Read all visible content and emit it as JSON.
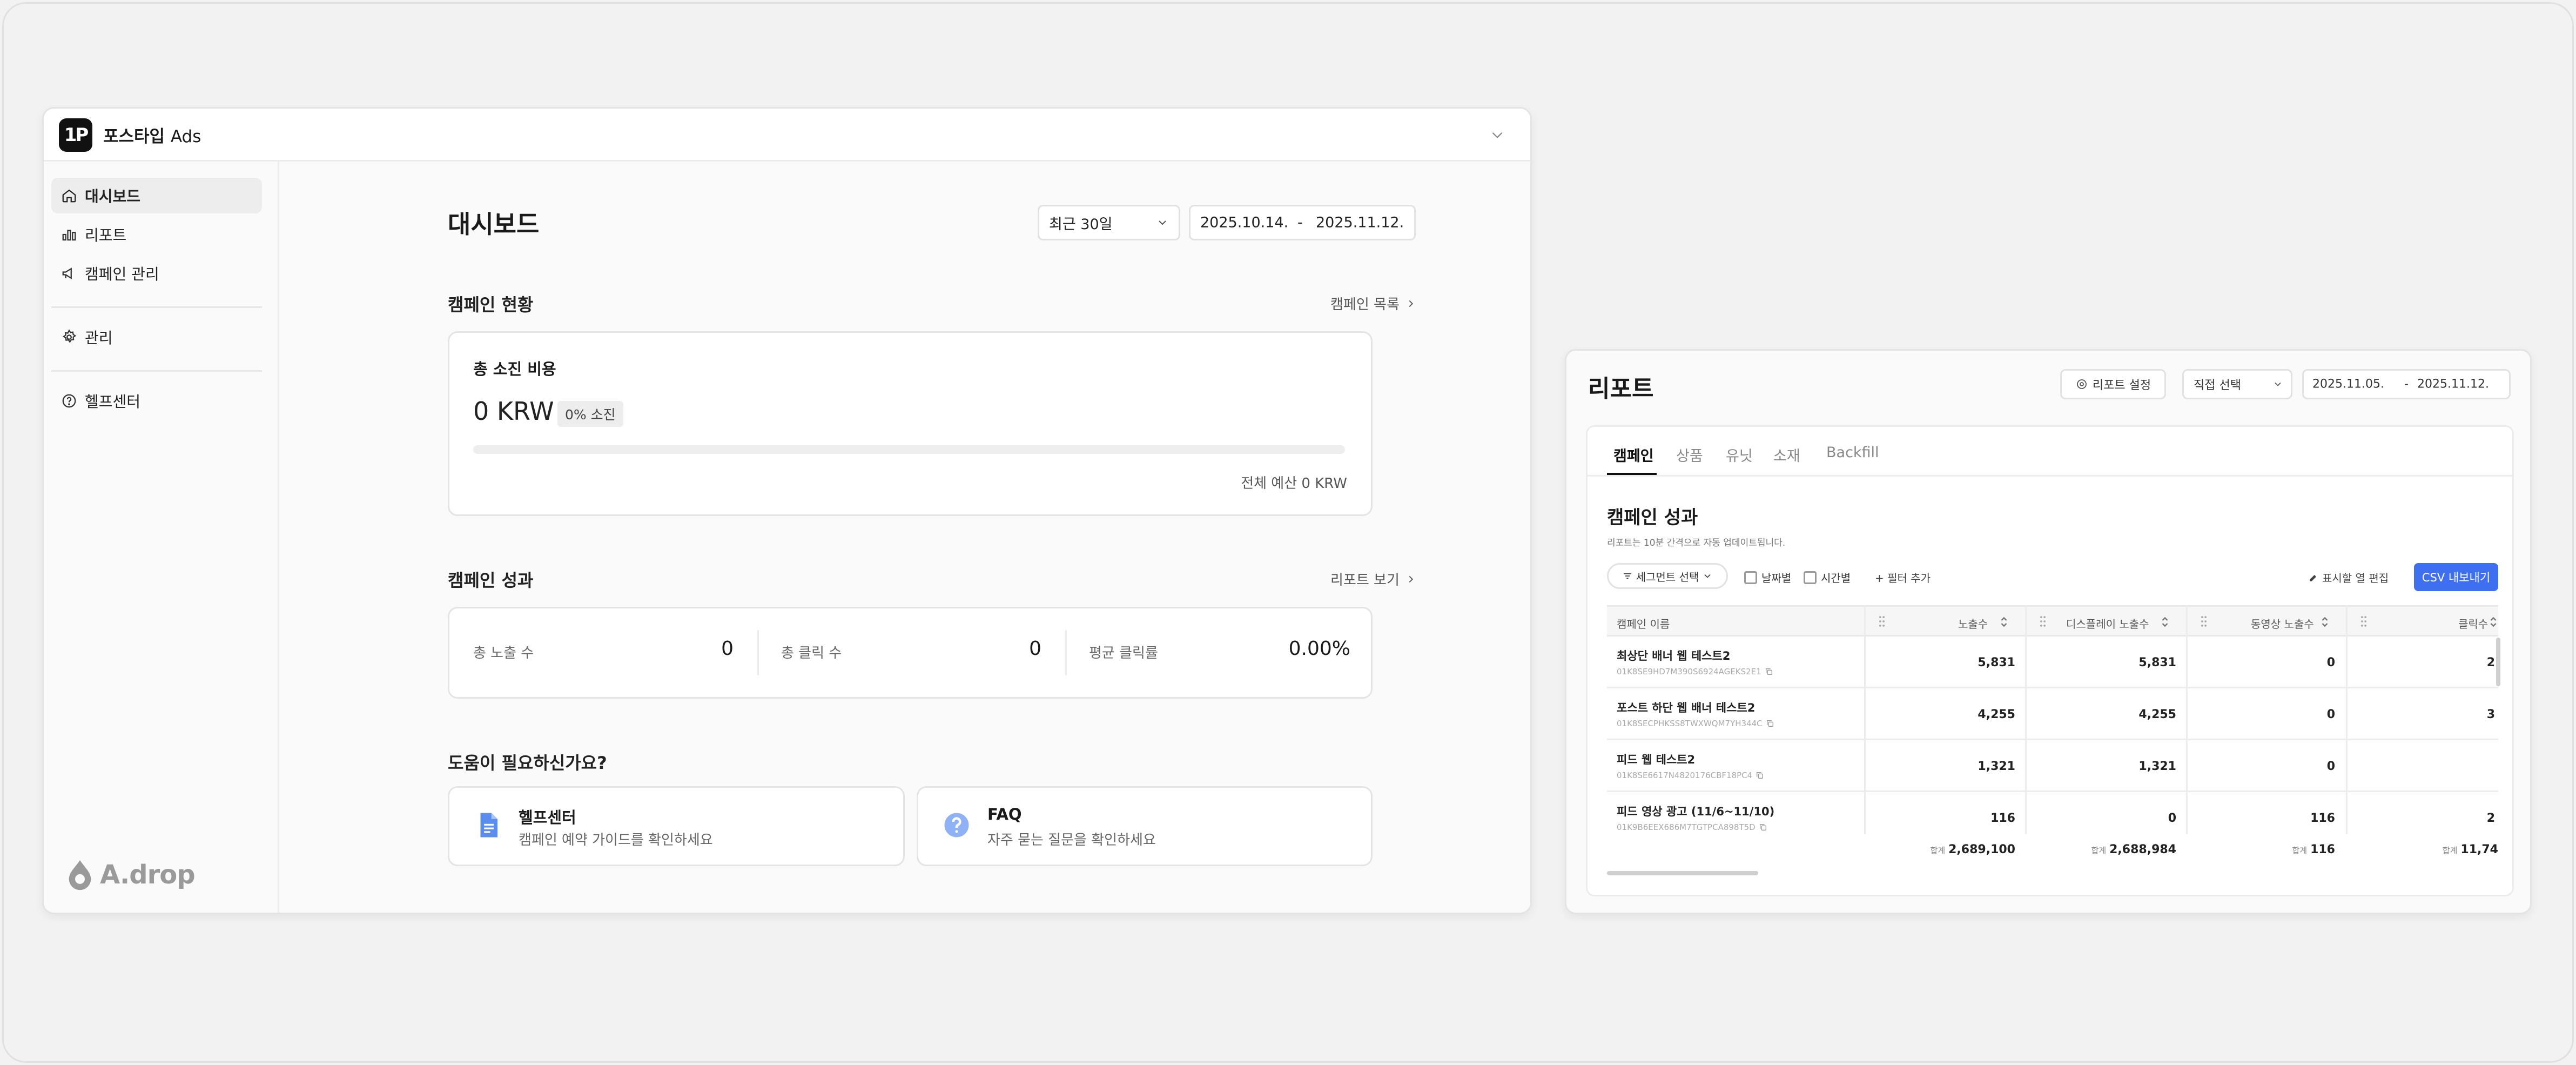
{
  "app": {
    "logo_text": "1P",
    "title_bold": "포스타입",
    "title_light": "Ads"
  },
  "sidebar": {
    "items": [
      {
        "label": "대시보드",
        "icon": "home-icon",
        "active": true
      },
      {
        "label": "리포트",
        "icon": "bar-chart-icon"
      },
      {
        "label": "캠페인 관리",
        "icon": "megaphone-icon"
      },
      {
        "label": "관리",
        "icon": "gear-icon"
      },
      {
        "label": "헬프센터",
        "icon": "help-circle-icon"
      }
    ],
    "footer_brand": "A.drop"
  },
  "dashboard": {
    "title": "대시보드",
    "period_select": "최근 30일",
    "date_start": "2025.10.14.",
    "date_sep": "-",
    "date_end": "2025.11.12.",
    "campaign_status": {
      "title": "캠페인 현황",
      "link": "캠페인 목록",
      "spend_label": "총 소진 비용",
      "spend_value": "0 KRW",
      "spend_badge": "0% 소진",
      "progress_fraction": 0,
      "budget_text": "전체 예산 0 KRW"
    },
    "campaign_performance": {
      "title": "캠페인 성과",
      "link": "리포트 보기",
      "metrics": [
        {
          "label": "총 노출 수",
          "value": "0"
        },
        {
          "label": "총 클릭 수",
          "value": "0"
        },
        {
          "label": "평균 클릭률",
          "value": "0.00%"
        }
      ]
    },
    "help": {
      "title": "도움이 필요하신가요?",
      "cards": [
        {
          "title": "헬프센터",
          "sub": "캠페인 예약 가이드를 확인하세요",
          "icon": "document-icon"
        },
        {
          "title": "FAQ",
          "sub": "자주 묻는 질문을 확인하세요",
          "icon": "question-icon"
        }
      ]
    }
  },
  "report": {
    "title": "리포트",
    "settings_button": "리포트 설정",
    "period_select": "직접 선택",
    "date_start": "2025.11.05.",
    "date_sep": "-",
    "date_end": "2025.11.12.",
    "tabs": [
      "캠페인",
      "상품",
      "유닛",
      "소재",
      "Backfill"
    ],
    "section_title": "캠페인 성과",
    "section_sub": "리포트는 10분 간격으로 자동 업데이트됩니다.",
    "segment_button": "세그먼트 선택",
    "checkbox_daily": "날짜별",
    "checkbox_hourly": "시간별",
    "add_filter": "+ 필터 추가",
    "edit_columns": "표시할 열 편집",
    "csv_button": "CSV 내보내기",
    "table": {
      "headers": [
        "캠페인 이름",
        "노출수",
        "디스플레이 노출수",
        "동영상 노출수",
        "클릭수"
      ],
      "rows": [
        {
          "name": "최상단 배너 웹 테스트2",
          "id": "01K8SE9HD7M390S6924AGEKS2E1",
          "values": [
            "5,831",
            "5,831",
            "0",
            "2"
          ]
        },
        {
          "name": "포스트 하단 웹 배너 테스트2",
          "id": "01K8SECPHKSS8TWXWQM7YH344C",
          "values": [
            "4,255",
            "4,255",
            "0",
            "3"
          ]
        },
        {
          "name": "피드 웹 테스트2",
          "id": "01K8SE6617N4820176CBF18PC4",
          "values": [
            "1,321",
            "1,321",
            "0",
            ""
          ]
        },
        {
          "name": "피드 영상 광고 (11/6~11/10)",
          "id": "01K9B6EEX686M7TGTPCA898T5D",
          "values": [
            "116",
            "0",
            "116",
            "2"
          ]
        }
      ],
      "total_prefix": "합계",
      "totals": [
        "2,689,100",
        "2,688,984",
        "116",
        "11,74"
      ]
    }
  }
}
